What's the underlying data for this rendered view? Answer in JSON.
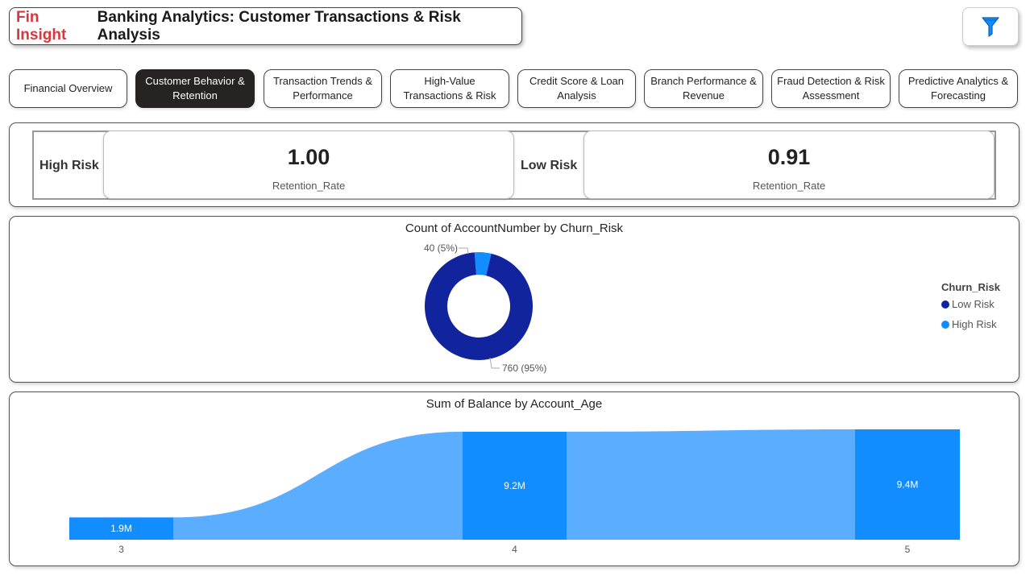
{
  "header": {
    "brand": "Fin Insight",
    "title": "Banking Analytics: Customer Transactions & Risk Analysis",
    "filter_icon": "funnel-icon"
  },
  "tabs": [
    {
      "label": "Financial Overview",
      "active": false
    },
    {
      "label": "Customer Behavior & Retention",
      "active": true
    },
    {
      "label": "Transaction Trends & Performance",
      "active": false
    },
    {
      "label": "High-Value Transactions & Risk",
      "active": false
    },
    {
      "label": "Credit Score & Loan Analysis",
      "active": false
    },
    {
      "label": "Branch Performance & Revenue",
      "active": false
    },
    {
      "label": "Fraud Detection & Risk Assessment",
      "active": false
    },
    {
      "label": "Predictive Analytics & Forecasting",
      "active": false
    }
  ],
  "kpis": [
    {
      "label": "High Risk",
      "value": "1.00",
      "measure": "Retention_Rate"
    },
    {
      "label": "Low Risk",
      "value": "0.91",
      "measure": "Retention_Rate"
    }
  ],
  "colors": {
    "brand": "#d9363e",
    "low_risk": "#12239e",
    "high_risk": "#118dff",
    "ribbon": "#5aadff",
    "bar": "#118dff",
    "active_tab": "#252423"
  },
  "chart_data": [
    {
      "type": "pie",
      "title": "Count of AccountNumber by Churn_Risk",
      "legend_title": "Churn_Risk",
      "legend_position": "right",
      "categories": [
        "Low Risk",
        "High Risk"
      ],
      "values": [
        760,
        40
      ],
      "data_labels": [
        "760 (95%)",
        "40 (5%)"
      ]
    },
    {
      "type": "bar",
      "title": "Sum of Balance by Account_Age",
      "categories": [
        "3",
        "4",
        "5"
      ],
      "values": [
        1.9,
        9.2,
        9.4
      ],
      "value_unit": "M",
      "data_labels": [
        "1.9M",
        "9.2M",
        "9.4M"
      ]
    }
  ]
}
